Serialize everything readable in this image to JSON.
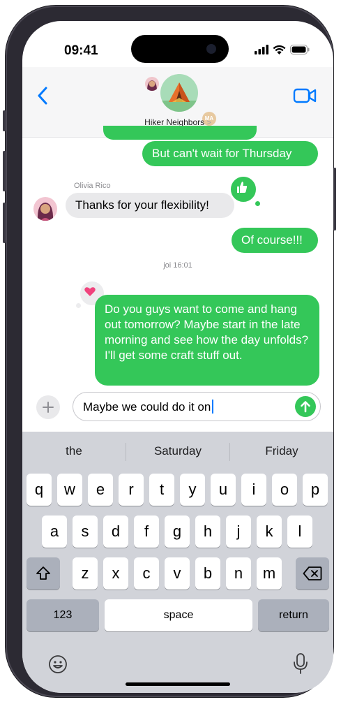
{
  "status_bar": {
    "time": "09:41"
  },
  "header": {
    "group_name": "Hiker Neighbors",
    "chevron": ">",
    "mini_avatar_initials": "MA"
  },
  "messages": {
    "msg1": "But can't wait for Thursday",
    "sender": "Olivia Rico",
    "msg2": "Thanks for your flexibility!",
    "msg3": "Of course!!!",
    "timestamp": "joi 16:01",
    "msg4": "Do you guys want to come and hang out tomorrow? Maybe start in the late morning and see how the day unfolds? I'll get some craft stuff out."
  },
  "composer": {
    "text": "Maybe we could do it on"
  },
  "keyboard": {
    "suggestions": [
      "the",
      "Saturday",
      "Friday"
    ],
    "row1": [
      "q",
      "w",
      "e",
      "r",
      "t",
      "y",
      "u",
      "i",
      "o",
      "p"
    ],
    "row2": [
      "a",
      "s",
      "d",
      "f",
      "g",
      "h",
      "j",
      "k",
      "l"
    ],
    "row3": [
      "z",
      "x",
      "c",
      "v",
      "b",
      "n",
      "m"
    ],
    "numbers_label": "123",
    "space_label": "space",
    "return_label": "return"
  },
  "colors": {
    "outgoing_bubble": "#34c759",
    "incoming_bubble": "#e9e9eb",
    "accent": "#007aff"
  },
  "icons": {
    "back": "chevron-left-icon",
    "video": "video-camera-icon",
    "plus": "plus-icon",
    "send": "arrow-up-icon",
    "shift": "shift-icon",
    "delete": "delete-icon",
    "emoji": "emoji-icon",
    "mic": "microphone-icon",
    "like": "thumbs-up-icon",
    "heart": "heart-icon"
  }
}
